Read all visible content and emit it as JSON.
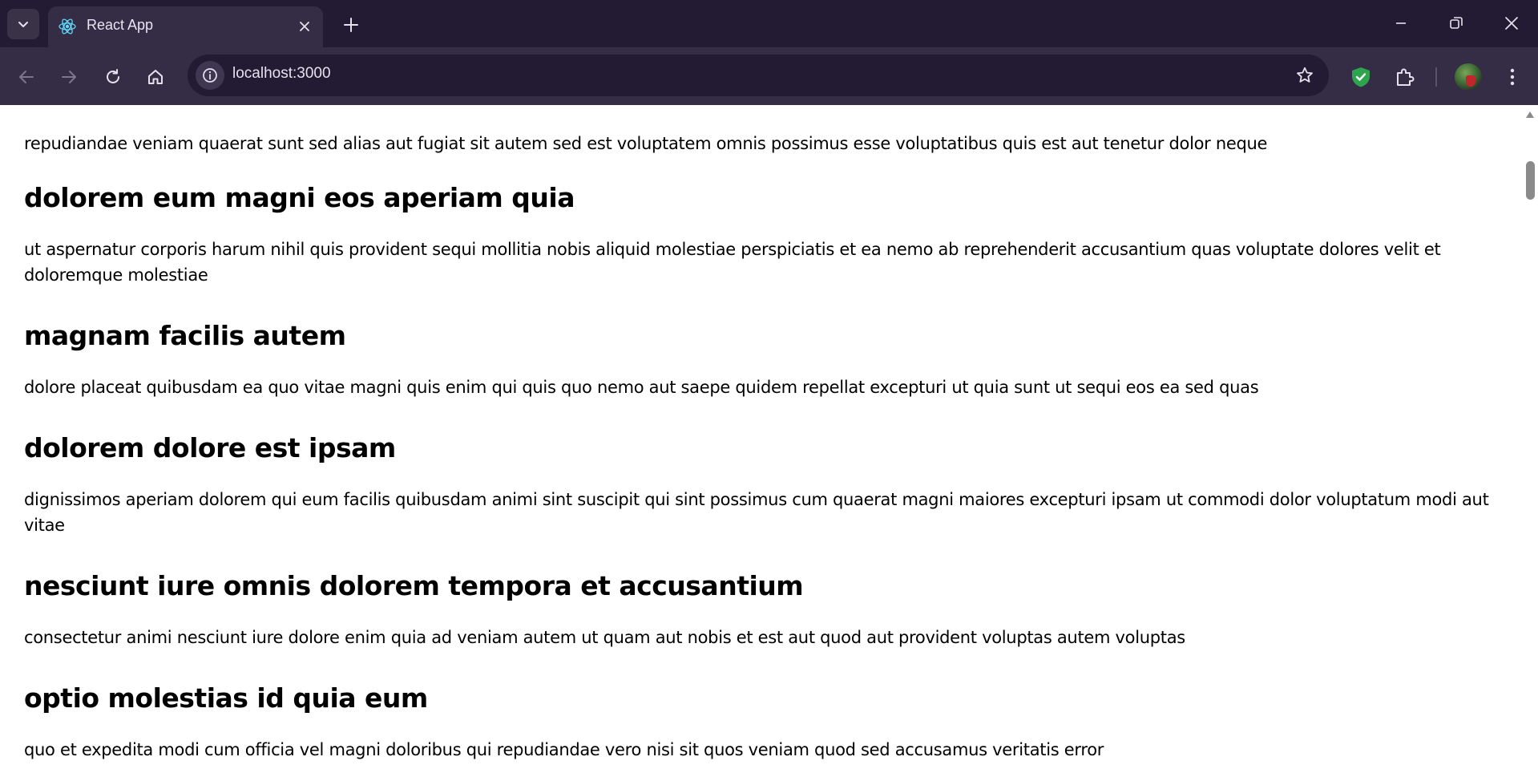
{
  "browser": {
    "tab": {
      "title": "React App",
      "favicon": "react-icon"
    },
    "address_bar": {
      "url": "localhost:3000"
    },
    "colors": {
      "tabstrip": "#231b33",
      "toolbar": "#352d45",
      "shield_extension": "#2ea44f"
    }
  },
  "page": {
    "intro_paragraph": "repudiandae veniam quaerat sunt sed alias aut fugiat sit autem sed est voluptatem omnis possimus esse voluptatibus quis est aut tenetur dolor neque",
    "posts": [
      {
        "title": "dolorem eum magni eos aperiam quia",
        "body": "ut aspernatur corporis harum nihil quis provident sequi mollitia nobis aliquid molestiae perspiciatis et ea nemo ab reprehenderit accusantium quas voluptate dolores velit et doloremque molestiae"
      },
      {
        "title": "magnam facilis autem",
        "body": "dolore placeat quibusdam ea quo vitae magni quis enim qui quis quo nemo aut saepe quidem repellat excepturi ut quia sunt ut sequi eos ea sed quas"
      },
      {
        "title": "dolorem dolore est ipsam",
        "body": "dignissimos aperiam dolorem qui eum facilis quibusdam animi sint suscipit qui sint possimus cum quaerat magni maiores excepturi ipsam ut commodi dolor voluptatum modi aut vitae"
      },
      {
        "title": "nesciunt iure omnis dolorem tempora et accusantium",
        "body": "consectetur animi nesciunt iure dolore enim quia ad veniam autem ut quam aut nobis et est aut quod aut provident voluptas autem voluptas"
      },
      {
        "title": "optio molestias id quia eum",
        "body": "quo et expedita modi cum officia vel magni doloribus qui repudiandae vero nisi sit quos veniam quod sed accusamus veritatis error"
      }
    ]
  }
}
